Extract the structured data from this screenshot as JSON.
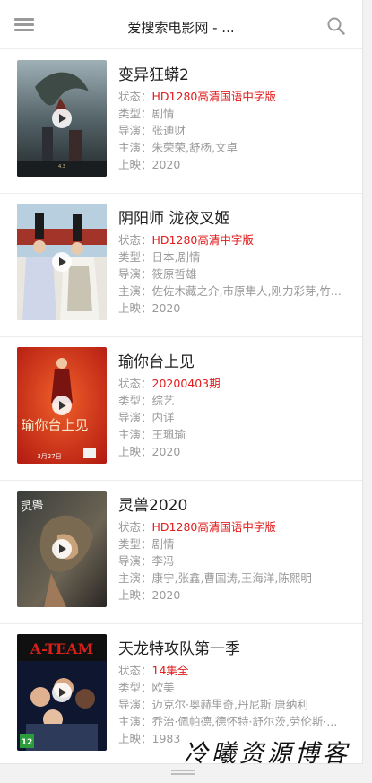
{
  "header": {
    "title": "爱搜索电影网 - ..."
  },
  "labels": {
    "status": "状态：",
    "genre": "类型：",
    "director": "导演：",
    "cast": "主演：",
    "release": "上映："
  },
  "movies": [
    {
      "title": "变异狂蟒2",
      "status": "HD1280高清国语中字版",
      "genre": "剧情",
      "director": "张迪财",
      "cast": "朱荣荣,舒杨,文卓",
      "release": "2020"
    },
    {
      "title": "阴阳师 泷夜叉姬",
      "status": "HD1280高清中字版",
      "genre": "日本,剧情",
      "director": "筱原哲雄",
      "cast": "佐佐木藏之介,市原隼人,刚力彩芽,竹...",
      "release": "2020"
    },
    {
      "title": "瑜你台上见",
      "status": "20200403期",
      "genre": "综艺",
      "director": "内详",
      "cast": "王珮瑜",
      "release": "2020"
    },
    {
      "title": "灵兽2020",
      "status": "HD1280高清国语中字版",
      "genre": "剧情",
      "director": "李冯",
      "cast": "康宁,张鑫,曹国涛,王海洋,陈熙明",
      "release": "2020"
    },
    {
      "title": "天龙特攻队第一季",
      "status": "14集全",
      "genre": "欧美",
      "director": "迈克尔·奥赫里奇,丹尼斯·唐纳利",
      "cast": "乔治·佩帕德,德怀特·舒尔茨,劳伦斯·...",
      "release": "1983"
    }
  ],
  "posters": {
    "p1_caption": "4.3",
    "p3_title": "瑜你台上见",
    "p3_date": "3月27日",
    "p4_title": "灵兽",
    "p5_title": "A-TEAM",
    "p5_rating": "12"
  },
  "watermark": "冷曦资源博客",
  "colors": {
    "status_red": "#e21b1b",
    "label_gray": "#9a9a9a",
    "title_dark": "#222222"
  },
  "icons": {
    "menu": "hamburger-menu-icon",
    "search": "search-icon",
    "play": "play-icon"
  }
}
